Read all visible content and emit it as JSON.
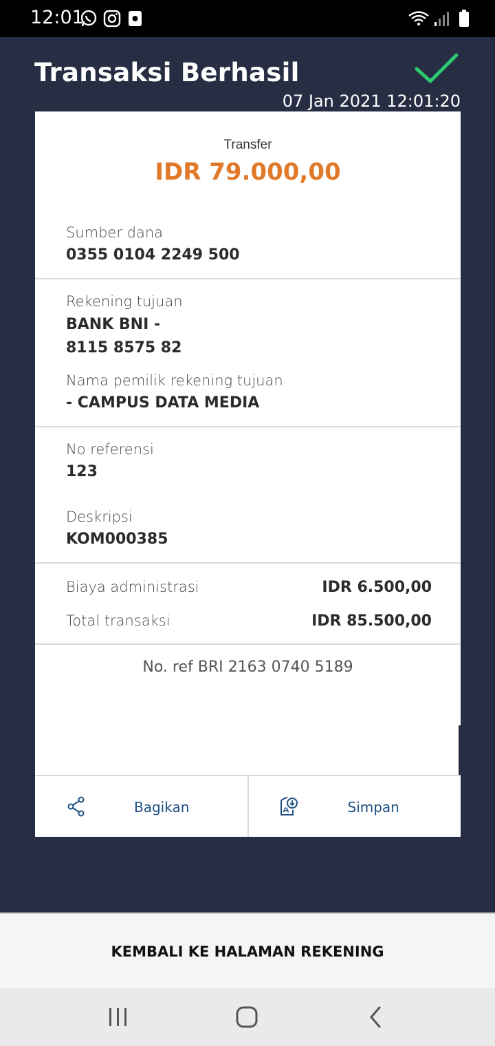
{
  "status_bar": {
    "time": "12:01",
    "left_icons": [
      "whatsapp-icon",
      "instagram-icon",
      "screenshot-icon"
    ],
    "right_icons": [
      "wifi-icon",
      "signal-icon",
      "battery-icon"
    ]
  },
  "header": {
    "title": "Transaksi Berhasil",
    "timestamp": "07 Jan 2021 12:01:20",
    "success_color": "#2ecc71"
  },
  "receipt": {
    "type": "Transfer",
    "amount": "IDR 79.000,00",
    "amount_color": "#e07a2a",
    "source_label": "Sumber dana",
    "source_value": "0355 0104 2249 500",
    "dest_label": "Rekening tujuan",
    "dest_bank": "BANK BNI -",
    "dest_account": "8115 8575 82",
    "owner_label": "Nama pemilik rekening tujuan",
    "owner_value": "- CAMPUS DATA MEDIA",
    "ref_label": "No referensi",
    "ref_value": "123",
    "desc_label": "Deskripsi",
    "desc_value": "KOM000385",
    "fee_label": "Biaya administrasi",
    "fee_value": "IDR 6.500,00",
    "total_label": "Total transaksi",
    "total_value": "IDR 85.500,00",
    "bri_ref": "No. ref BRI 2163 0740 5189"
  },
  "actions": {
    "share_label": "Bagikan",
    "save_label": "Simpan",
    "accent": "#1d4f84"
  },
  "bottom": {
    "back_label": "KEMBALI KE HALAMAN REKENING"
  },
  "nav_bar": {
    "icons": [
      "recent-apps-icon",
      "home-icon",
      "back-icon"
    ]
  }
}
